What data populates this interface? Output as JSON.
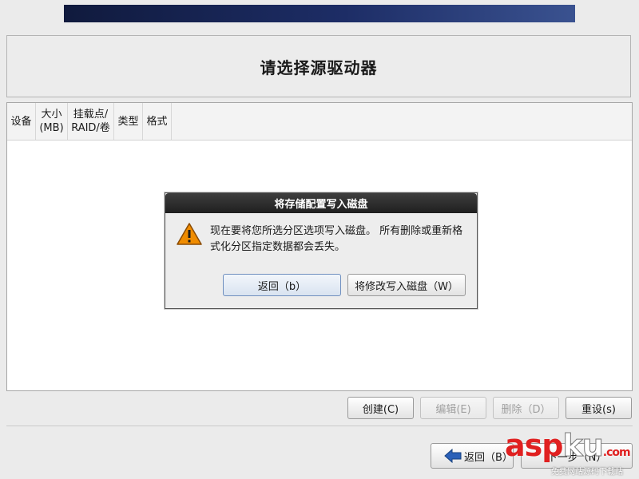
{
  "header": {
    "title": "请选择源驱动器"
  },
  "table": {
    "columns": [
      {
        "line1": "设备",
        "line2": ""
      },
      {
        "line1": "大小",
        "line2": "(MB)"
      },
      {
        "line1": "挂载点/",
        "line2": "RAID/卷"
      },
      {
        "line1": "类型",
        "line2": ""
      },
      {
        "line1": "格式",
        "line2": ""
      }
    ]
  },
  "actions": {
    "create": "创建(C)",
    "edit": "编辑(E)",
    "delete": "删除（D）",
    "reset": "重设(s)"
  },
  "nav": {
    "back": "返回（B）",
    "next": "下一步（N）"
  },
  "dialog": {
    "title": "将存储配置写入磁盘",
    "message": "现在要将您所选分区选项写入磁盘。 所有删除或重新格式化分区指定数据都会丢失。",
    "back_button": "返回（b）",
    "write_button": "将修改写入磁盘（W）",
    "icon": "warning-icon"
  },
  "watermark": {
    "main_a": "asp",
    "main_b": "ku",
    "suffix": ".com",
    "sub": "免费网站源码下载站"
  },
  "colors": {
    "banner": "#1d2d66",
    "warning": "#f08c00",
    "watermark": "#e02020"
  }
}
